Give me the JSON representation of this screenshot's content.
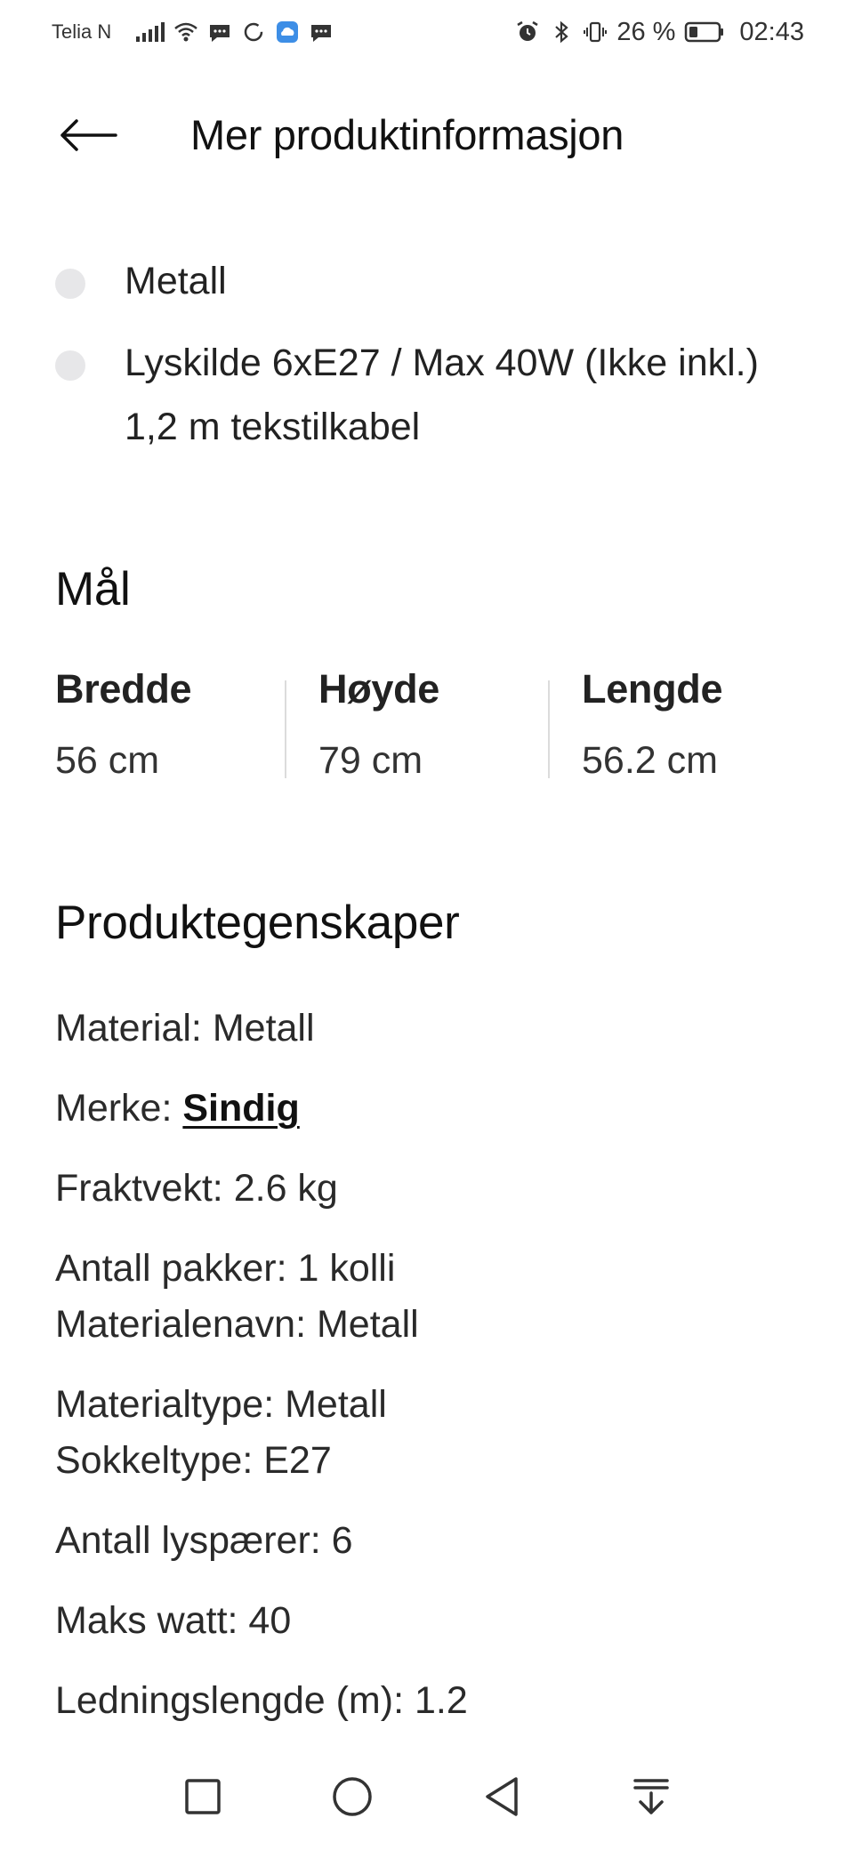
{
  "status_bar": {
    "carrier": "Telia N",
    "battery_percent": "26 %",
    "time": "02:43"
  },
  "header": {
    "title": "Mer produktinformasjon"
  },
  "bullets": [
    "Metall",
    "Lyskilde 6xE27 / Max 40W (Ikke inkl.) 1,2 m tekstilkabel"
  ],
  "dimensions": {
    "heading": "Mål",
    "items": [
      {
        "label": "Bredde",
        "value": "56 cm"
      },
      {
        "label": "Høyde",
        "value": "79 cm"
      },
      {
        "label": "Lengde",
        "value": "56.2 cm"
      }
    ]
  },
  "properties": {
    "heading": "Produktegenskaper",
    "material": "Material: Metall",
    "brand_prefix": "Merke: ",
    "brand_link": "Sindig",
    "freight_weight": "Fraktvekt: 2.6 kg",
    "packages": "Antall pakker: 1 kolli",
    "material_name": "Materialenavn: Metall",
    "material_type": "Materialtype: Metall",
    "socket_type": "Sokkeltype: E27",
    "bulb_count": "Antall lyspærer: 6",
    "max_watt": "Maks watt: 40",
    "cord_length": "Ledningslengde (m): 1.2"
  },
  "icons": {
    "back": "arrow-left-icon",
    "nav_recent": "square-icon",
    "nav_home": "circle-icon",
    "nav_back": "triangle-back-icon",
    "nav_dropdown": "notification-pull-icon"
  },
  "colors": {
    "bullet_dot": "#e7e7e9",
    "divider": "#dcdcdc",
    "text": "#111111"
  }
}
